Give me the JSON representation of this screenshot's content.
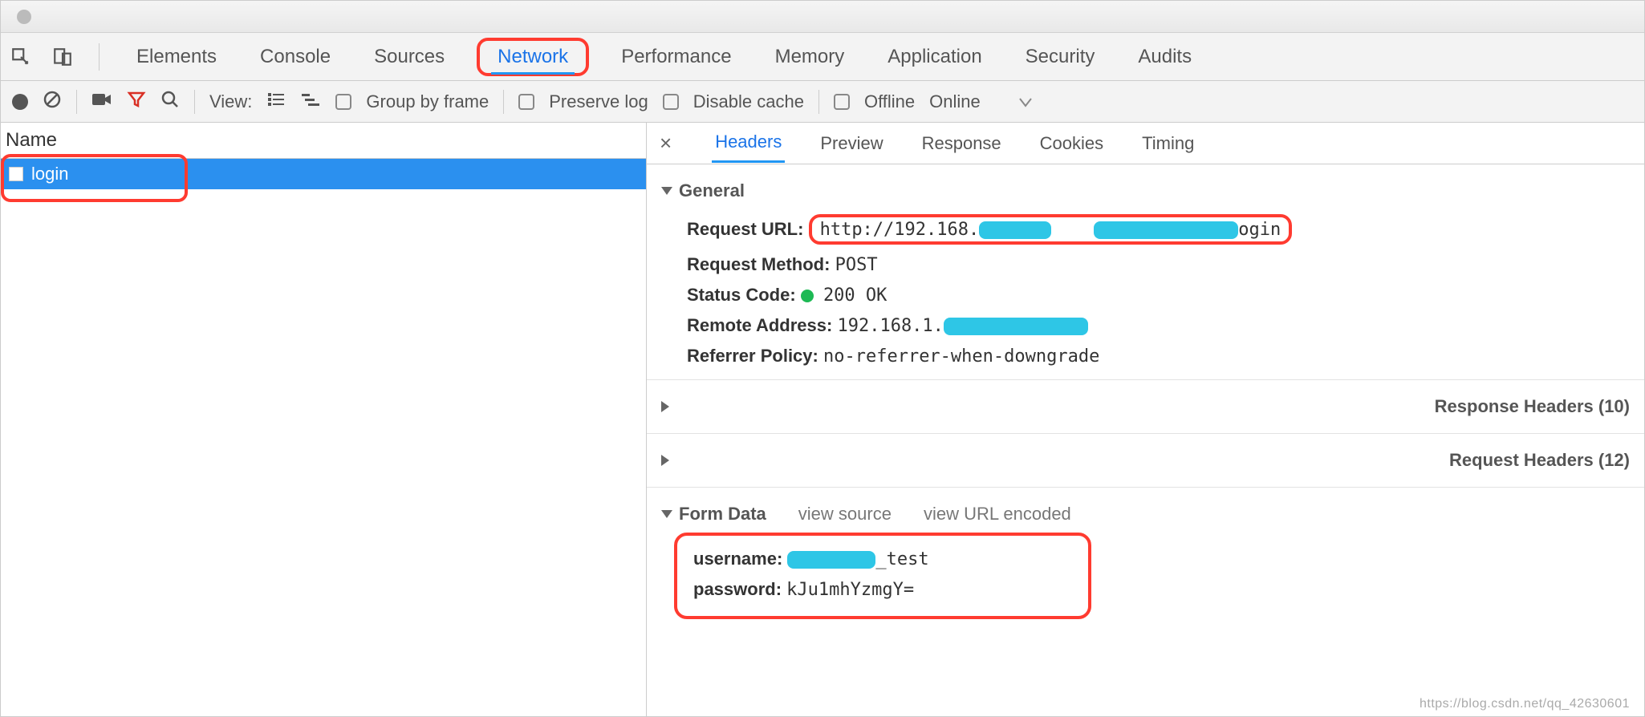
{
  "topTabs": {
    "elements": "Elements",
    "console": "Console",
    "sources": "Sources",
    "network": "Network",
    "performance": "Performance",
    "memory": "Memory",
    "application": "Application",
    "security": "Security",
    "audits": "Audits"
  },
  "toolbar": {
    "viewLabel": "View:",
    "groupByFrame": "Group by frame",
    "preserveLog": "Preserve log",
    "disableCache": "Disable cache",
    "offline": "Offline",
    "online": "Online"
  },
  "leftPanel": {
    "nameHeader": "Name",
    "requests": [
      {
        "name": "login"
      }
    ]
  },
  "detailTabs": {
    "headers": "Headers",
    "preview": "Preview",
    "response": "Response",
    "cookies": "Cookies",
    "timing": "Timing"
  },
  "sections": {
    "general": "General",
    "responseHeaders": "Response Headers (10)",
    "requestHeaders": "Request Headers (12)",
    "formData": "Form Data",
    "viewSource": "view source",
    "viewUrlEncoded": "view URL encoded"
  },
  "general": {
    "requestUrlLabel": "Request URL:",
    "requestUrlPrefix": "http://192.168.",
    "requestUrlSuffix": "ogin",
    "requestMethodLabel": "Request Method:",
    "requestMethodValue": "POST",
    "statusCodeLabel": "Status Code:",
    "statusCodeValue": "200 OK",
    "remoteAddressLabel": "Remote Address:",
    "remoteAddressPrefix": "192.168.1.",
    "referrerPolicyLabel": "Referrer Policy:",
    "referrerPolicyValue": "no-referrer-when-downgrade"
  },
  "formData": {
    "usernameLabel": "username:",
    "usernameSuffix": "_test",
    "passwordLabel": "password:",
    "passwordValue": "kJu1mhYzmgY="
  },
  "watermark": "https://blog.csdn.net/qq_42630601"
}
